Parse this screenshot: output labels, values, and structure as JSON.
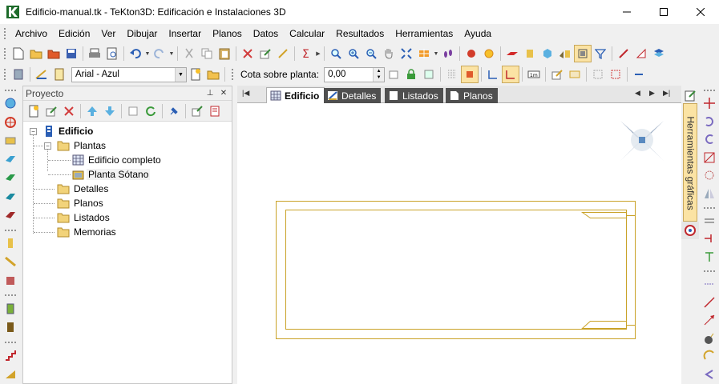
{
  "window": {
    "title": "Edificio-manual.tk - TeKton3D: Edificación e Instalaciones 3D",
    "app_icon": "tekton-k-icon",
    "controls": [
      "minimize-icon",
      "maximize-icon",
      "close-icon"
    ]
  },
  "menubar": {
    "items": [
      "Archivo",
      "Edición",
      "Ver",
      "Dibujar",
      "Insertar",
      "Planos",
      "Datos",
      "Calcular",
      "Resultados",
      "Herramientas",
      "Ayuda"
    ]
  },
  "toolbar2": {
    "font_select_value": "Arial - Azul",
    "cota_label": "Cota sobre planta:",
    "cota_value": "0,00"
  },
  "project_panel": {
    "title": "Proyecto",
    "pin_icon": "pin-icon",
    "close_icon": "close-icon",
    "tree": {
      "root": "Edificio",
      "plantas": "Plantas",
      "edificio_completo": "Edificio completo",
      "planta_sotano": "Planta Sótano",
      "detalles": "Detalles",
      "planos": "Planos",
      "listados": "Listados",
      "memorias": "Memorias"
    }
  },
  "document": {
    "tabs": [
      "Edificio",
      "Detalles",
      "Listados",
      "Planos"
    ],
    "active_tab": "Edificio"
  },
  "side_panel": {
    "label": "Herramientas gráficas"
  },
  "colors": {
    "drawing_line": "#c9a227",
    "tab_dark": "#4f4f4f",
    "side_tab": "#fbe3a4"
  }
}
